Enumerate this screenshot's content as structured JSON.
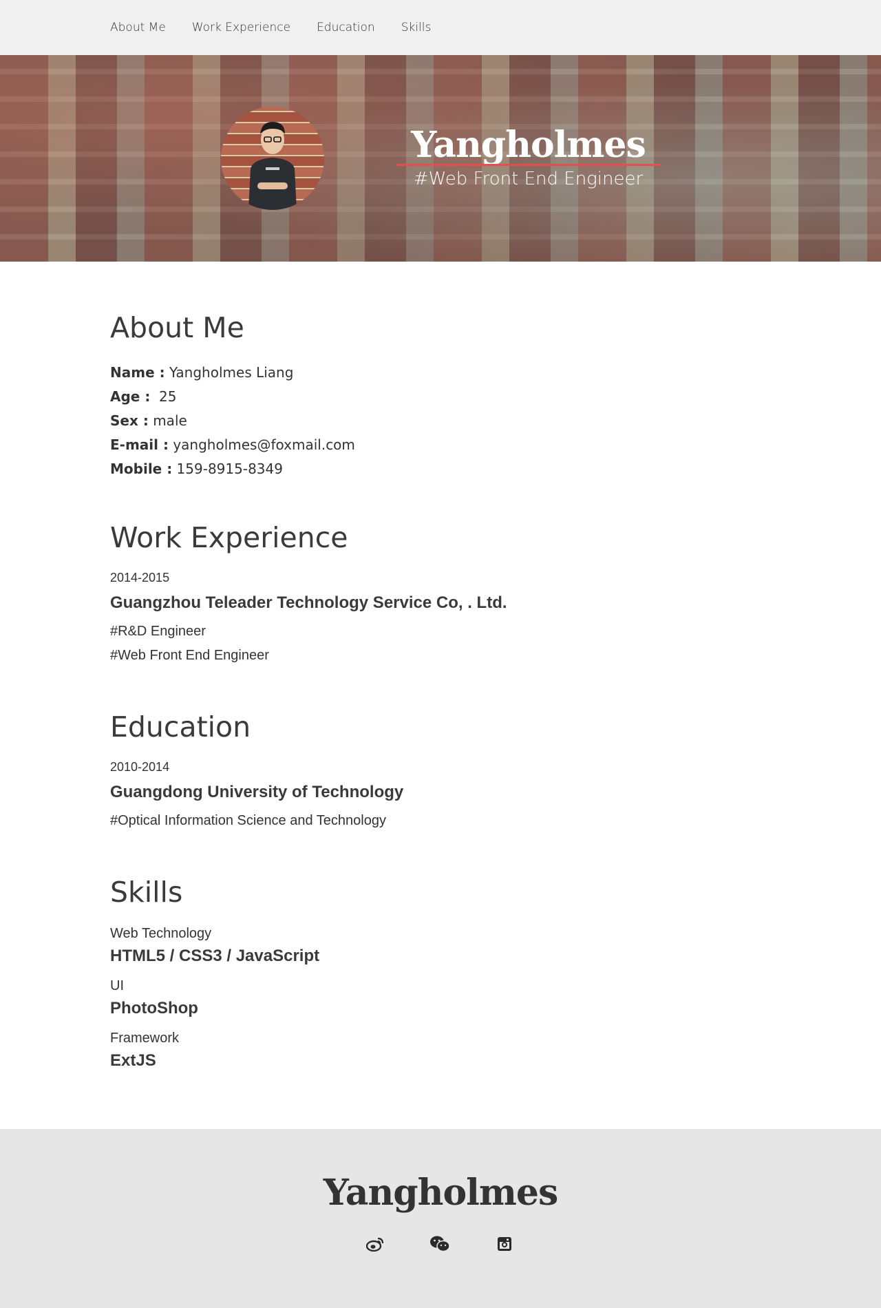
{
  "nav": {
    "items": [
      "About Me",
      "Work Experience",
      "Education",
      "Skills"
    ]
  },
  "hero": {
    "name": "Yangholmes",
    "title": "#Web Front End Engineer",
    "accent_color": "#e0504f"
  },
  "about": {
    "heading": "About Me",
    "fields": [
      {
        "label": "Name :",
        "value": " Yangholmes Liang"
      },
      {
        "label": "Age :",
        "value": "  25"
      },
      {
        "label": "Sex :",
        "value": " male"
      },
      {
        "label": "E-mail :",
        "value": " yangholmes@foxmail.com"
      },
      {
        "label": "Mobile :",
        "value": " 159-8915-8349"
      }
    ]
  },
  "work": {
    "heading": "Work Experience",
    "period": "2014-2015",
    "company": "Guangzhou Teleader Technology Service Co, . Ltd.",
    "roles": [
      "#R&D Engineer",
      "#Web Front End Engineer"
    ]
  },
  "education": {
    "heading": "Education",
    "period": "2010-2014",
    "school": "Guangdong University of Technology",
    "major": "#Optical Information Science and Technology"
  },
  "skills": {
    "heading": "Skills",
    "items": [
      {
        "category": "Web Technology",
        "name": "HTML5 / CSS3 / JavaScript"
      },
      {
        "category": "UI",
        "name": "PhotoShop"
      },
      {
        "category": "Framework",
        "name": "ExtJS"
      }
    ]
  },
  "footer": {
    "name": "Yangholmes",
    "icons": [
      "weibo-icon",
      "wechat-icon",
      "instagram-icon"
    ]
  }
}
